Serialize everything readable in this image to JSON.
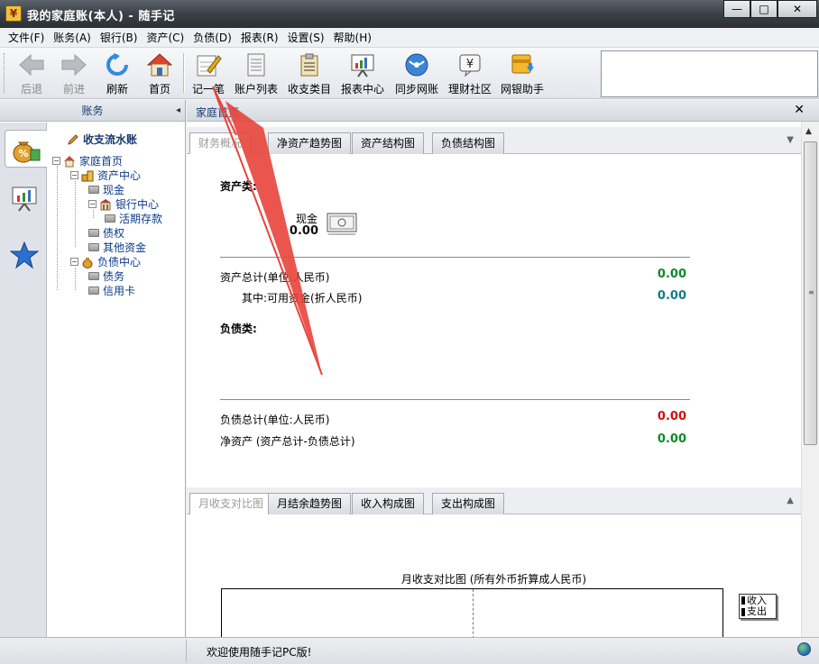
{
  "window": {
    "title": "我的家庭账(本人) - 随手记",
    "minimize": "—",
    "maximize": "□",
    "close": "✕"
  },
  "menu": [
    "文件(F)",
    "账务(A)",
    "银行(B)",
    "资产(C)",
    "负债(D)",
    "报表(R)",
    "设置(S)",
    "帮助(H)"
  ],
  "toolbar": {
    "back": "后退",
    "forward": "前进",
    "refresh": "刷新",
    "home": "首页",
    "record": "记一笔",
    "account_list": "账户列表",
    "category": "收支类目",
    "report": "报表中心",
    "sync": "同步网账",
    "community": "理财社区",
    "bank_helper": "网银助手"
  },
  "left_panel": {
    "header": "账务",
    "tree": {
      "root": "收支流水账",
      "home": "家庭首页",
      "asset_center": "资产中心",
      "cash": "现金",
      "bank_center": "银行中心",
      "deposit": "活期存款",
      "claims": "债权",
      "other_funds": "其他资金",
      "liability_center": "负债中心",
      "debts": "债务",
      "credit_card": "信用卡"
    }
  },
  "main": {
    "title": "家庭首页",
    "tabs_top": [
      "财务概况",
      "净资产趋势图",
      "资产结构图",
      "负债结构图"
    ],
    "overview": {
      "assets_heading": "资产类:",
      "cash_label": "现金",
      "cash_value": "0.00",
      "assets_total_label": "资产总计(单位:人民币)",
      "assets_total_value": "0.00",
      "available_label": "其中:可用资金(折人民币)",
      "available_value": "0.00",
      "liabilities_heading": "负债类:",
      "liabilities_total_label": "负债总计(单位:人民币)",
      "liabilities_total_value": "0.00",
      "net_assets_label": "净资产 (资产总计-负债总计)",
      "net_assets_value": "0.00"
    },
    "tabs_bottom": [
      "月收支对比图",
      "月结余趋势图",
      "收入构成图",
      "支出构成图"
    ],
    "chart": {
      "title": "月收支对比图 (所有外币折算成人民币)",
      "legend": [
        "收入",
        "支出"
      ]
    }
  },
  "status": {
    "welcome": "欢迎使用随手记PC版!"
  },
  "colors": {
    "positive": "#0f8a2a",
    "available": "#187a8a",
    "negative": "#d01010",
    "annotation": "#e8443a"
  }
}
